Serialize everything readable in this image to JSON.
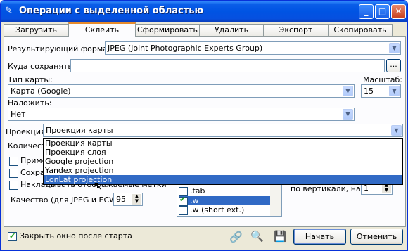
{
  "window": {
    "title": "Операции с выделенной областью"
  },
  "tabs": [
    {
      "label": "Загрузить"
    },
    {
      "label": "Склеить"
    },
    {
      "label": "Сформировать"
    },
    {
      "label": "Удалить"
    },
    {
      "label": "Экспорт"
    },
    {
      "label": "Скопировать"
    }
  ],
  "form": {
    "result_format_label": "Результирующий формат:",
    "result_format_value": "JPEG (Joint Photographic Experts Group)",
    "save_to_label": "Куда сохранять:",
    "save_to_value": "",
    "browse_label": "...",
    "map_type_label": "Тип карты:",
    "map_type_value": "Карта (Google)",
    "scale_label": "Масштаб:",
    "scale_value": "15",
    "overlay_label": "Наложить:",
    "overlay_value": "Нет",
    "projection_label": "Проекция:",
    "projection_value": "Проекция карты",
    "count_label": "Количеств",
    "apply_label": "Примен",
    "save_label": "Сохран",
    "overlay_marks_label": "Накладывать отображаемые метки",
    "quality_label": "Качество (для JPEG и ECW):",
    "quality_value": "95",
    "vertical_label": "по вертикали, на",
    "vertical_value": "1"
  },
  "projection_options": [
    {
      "label": "Проекция карты"
    },
    {
      "label": "Проекция слоя"
    },
    {
      "label": "Google projection"
    },
    {
      "label": "Yandex projection"
    },
    {
      "label": "LonLat projection"
    }
  ],
  "file_list": [
    {
      "label": ".tab"
    },
    {
      "label": ".w"
    },
    {
      "label": ".w (short ext.)"
    }
  ],
  "footer": {
    "close_after_start_label": "Закрыть окно после старта",
    "start_label": "Начать",
    "cancel_label": "Отменить"
  }
}
